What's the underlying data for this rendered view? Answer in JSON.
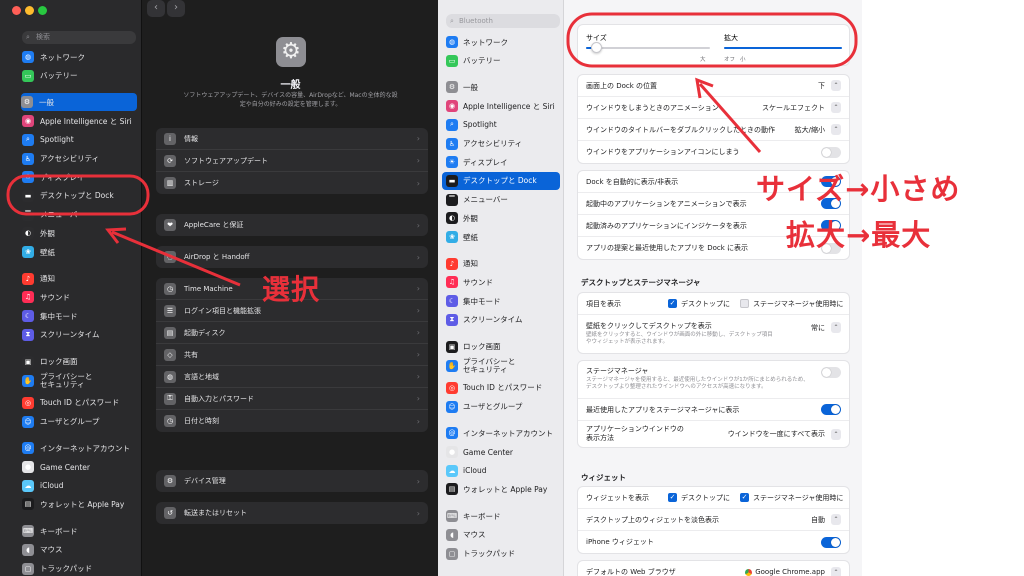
{
  "left": {
    "search_placeholder": "検索",
    "sidebar_items": [
      {
        "label": "ネットワーク",
        "icon": "globe-icon",
        "color": "#1e7cf2"
      },
      {
        "label": "バッテリー",
        "icon": "battery-icon",
        "color": "#34c759"
      },
      {
        "label": "一般",
        "icon": "gear-icon",
        "color": "#8e8e93",
        "selected": true
      },
      {
        "label": "Apple Intelligence と Siri",
        "icon": "siri-icon",
        "color": "#e0457b"
      },
      {
        "label": "Spotlight",
        "icon": "search-icon",
        "color": "#1e7cf2"
      },
      {
        "label": "アクセシビリティ",
        "icon": "accessibility-icon",
        "color": "#1e7cf2"
      },
      {
        "label": "ディスプレイ",
        "icon": "display-icon",
        "color": "#1e7cf2"
      },
      {
        "label": "デスクトップと Dock",
        "icon": "dock-icon",
        "color": "#2c2c2e"
      },
      {
        "label": "メニューバー",
        "icon": "menubar-icon",
        "color": "#2c2c2e"
      },
      {
        "label": "外観",
        "icon": "appearance-icon",
        "color": "#2c2c2e"
      },
      {
        "label": "壁紙",
        "icon": "wallpaper-icon",
        "color": "#32ade6"
      },
      {
        "label": "通知",
        "icon": "bell-icon",
        "color": "#ff3b30"
      },
      {
        "label": "サウンド",
        "icon": "speaker-icon",
        "color": "#ff2d55"
      },
      {
        "label": "集中モード",
        "icon": "moon-icon",
        "color": "#5e5ce6"
      },
      {
        "label": "スクリーンタイム",
        "icon": "hourglass-icon",
        "color": "#5e5ce6"
      },
      {
        "label": "ロック画面",
        "icon": "lock-screen-icon",
        "color": "#2c2c2e"
      },
      {
        "label": "プライバシーと",
        "label2": "セキュリティ",
        "icon": "hand-icon",
        "color": "#1e7cf2"
      },
      {
        "label": "Touch ID とパスワード",
        "icon": "fingerprint-icon",
        "color": "#ff3b30"
      },
      {
        "label": "ユーザとグループ",
        "icon": "users-icon",
        "color": "#1e7cf2"
      },
      {
        "label": "インターネットアカウント",
        "icon": "at-icon",
        "color": "#1e7cf2"
      },
      {
        "label": "Game Center",
        "icon": "game-center-icon",
        "color": "#e5e5e7"
      },
      {
        "label": "iCloud",
        "icon": "cloud-icon",
        "color": "#5ac8fa"
      },
      {
        "label": "ウォレットと Apple Pay",
        "icon": "wallet-icon",
        "color": "#1c1c1e"
      },
      {
        "label": "キーボード",
        "icon": "keyboard-icon",
        "color": "#8e8e93"
      },
      {
        "label": "マウス",
        "icon": "mouse-icon",
        "color": "#8e8e93"
      },
      {
        "label": "トラックパッド",
        "icon": "trackpad-icon",
        "color": "#8e8e93"
      }
    ],
    "main": {
      "title": "一般",
      "description": "ソフトウェアアップデート、デバイスの容量、AirDropなど、Macの全体的な設定や自分の好みの設定を管理します。",
      "groups": [
        [
          {
            "label": "情報",
            "icon": "info-icon"
          },
          {
            "label": "ソフトウェアアップデート",
            "icon": "software-update-icon"
          },
          {
            "label": "ストレージ",
            "icon": "storage-icon"
          }
        ],
        [
          {
            "label": "AppleCare と保証",
            "icon": "applecare-icon"
          }
        ],
        [
          {
            "label": "AirDrop と Handoff",
            "icon": "airdrop-icon"
          }
        ],
        [
          {
            "label": "Time Machine",
            "icon": "time-machine-icon"
          },
          {
            "label": "ログイン項目と機能拡張",
            "icon": "login-items-icon"
          },
          {
            "label": "起動ディスク",
            "icon": "startup-disk-icon"
          },
          {
            "label": "共有",
            "icon": "sharing-icon"
          },
          {
            "label": "言語と地域",
            "icon": "language-icon"
          },
          {
            "label": "自動入力とパスワード",
            "icon": "autofill-icon"
          },
          {
            "label": "日付と時刻",
            "icon": "clock-icon"
          }
        ],
        [
          {
            "label": "デバイス管理",
            "icon": "device-management-icon"
          }
        ],
        [
          {
            "label": "転送またはリセット",
            "icon": "reset-icon"
          }
        ]
      ]
    }
  },
  "right": {
    "search_placeholder": "Bluetooth",
    "sidebar_items": [
      {
        "label": "ネットワーク",
        "icon": "globe-icon",
        "color": "#1e7cf2"
      },
      {
        "label": "バッテリー",
        "icon": "battery-icon",
        "color": "#34c759"
      },
      {
        "label": "一般",
        "icon": "gear-icon",
        "color": "#8e8e93"
      },
      {
        "label": "Apple Intelligence と Siri",
        "icon": "siri-icon",
        "color": "#e0457b"
      },
      {
        "label": "Spotlight",
        "icon": "search-icon",
        "color": "#1e7cf2"
      },
      {
        "label": "アクセシビリティ",
        "icon": "accessibility-icon",
        "color": "#1e7cf2"
      },
      {
        "label": "ディスプレイ",
        "icon": "display-icon",
        "color": "#1e7cf2"
      },
      {
        "label": "デスクトップと Dock",
        "icon": "dock-icon",
        "color": "#1c1c1e",
        "selected": true
      },
      {
        "label": "メニューバー",
        "icon": "menubar-icon",
        "color": "#1c1c1e"
      },
      {
        "label": "外観",
        "icon": "appearance-icon",
        "color": "#1c1c1e"
      },
      {
        "label": "壁紙",
        "icon": "wallpaper-icon",
        "color": "#32ade6"
      },
      {
        "label": "通知",
        "icon": "bell-icon",
        "color": "#ff3b30"
      },
      {
        "label": "サウンド",
        "icon": "speaker-icon",
        "color": "#ff2d55"
      },
      {
        "label": "集中モード",
        "icon": "moon-icon",
        "color": "#5e5ce6"
      },
      {
        "label": "スクリーンタイム",
        "icon": "hourglass-icon",
        "color": "#5e5ce6"
      },
      {
        "label": "ロック画面",
        "icon": "lock-screen-icon",
        "color": "#1c1c1e"
      },
      {
        "label": "プライバシーと",
        "label2": "セキュリティ",
        "icon": "hand-icon",
        "color": "#1e7cf2"
      },
      {
        "label": "Touch ID とパスワード",
        "icon": "fingerprint-icon",
        "color": "#ff3b30"
      },
      {
        "label": "ユーザとグループ",
        "icon": "users-icon",
        "color": "#1e7cf2"
      },
      {
        "label": "インターネットアカウント",
        "icon": "at-icon",
        "color": "#1e7cf2"
      },
      {
        "label": "Game Center",
        "icon": "game-center-icon",
        "color": "#e5e5e7"
      },
      {
        "label": "iCloud",
        "icon": "cloud-icon",
        "color": "#5ac8fa"
      },
      {
        "label": "ウォレットと Apple Pay",
        "icon": "wallet-icon",
        "color": "#1c1c1e"
      },
      {
        "label": "キーボード",
        "icon": "keyboard-icon",
        "color": "#8e8e93"
      },
      {
        "label": "マウス",
        "icon": "mouse-icon",
        "color": "#8e8e93"
      },
      {
        "label": "トラックパッド",
        "icon": "trackpad-icon",
        "color": "#8e8e93"
      }
    ],
    "dock": {
      "size_label": "サイズ",
      "size_value": 0.08,
      "size_max_label": "大",
      "magnification_label": "拡大",
      "magnification_value": 1.0,
      "mag_off_label": "オフ",
      "mag_small_label": "小",
      "mag_large_label": "大",
      "rows_a": [
        {
          "label": "画面上の Dock の位置",
          "value": "下",
          "control": "stepper"
        },
        {
          "label": "ウインドウをしまうときのアニメーション",
          "value": "スケールエフェクト",
          "control": "stepper"
        },
        {
          "label": "ウインドウのタイトルバーをダブルクリックしたときの動作",
          "value": "拡大/縮小",
          "control": "stepper"
        },
        {
          "label": "ウインドウをアプリケーションアイコンにしまう",
          "control": "toggle",
          "on": false
        }
      ],
      "rows_b": [
        {
          "label": "Dock を自動的に表示/非表示",
          "control": "toggle",
          "on": true
        },
        {
          "label": "起動中のアプリケーションをアニメーションで表示",
          "control": "toggle",
          "on": true
        },
        {
          "label": "起動済みのアプリケーションにインジケータを表示",
          "control": "toggle",
          "on": true
        },
        {
          "label": "アプリの提案と最近使用したアプリを Dock に表示",
          "control": "toggle",
          "on": false
        }
      ]
    },
    "stage": {
      "section_title": "デスクトップとステージマネージャ",
      "show_items_label": "項目を表示",
      "desktop_check_label": "デスクトップに",
      "desktop_checked": true,
      "stage_check_label": "ステージマネージャ使用時に",
      "stage_checked": false,
      "wallpaper_label": "壁紙をクリックしてデスクトップを表示",
      "wallpaper_sub": "壁紙をクリックすると、ウインドウが画面の外に移動し、デスクトップ項目やウィジェットが表示されます。",
      "wallpaper_value": "常に",
      "stage_label": "ステージマネージャ",
      "stage_sub": "ステージマネージャを使用すると、最近使用したウインドウが1か所にまとめられるため、デスクトップより整理されたウインドウへのアクセスが高速になります。",
      "recent_apps_label": "最近使用したアプリをステージマネージャに表示",
      "app_windows_label": "アプリケーションウインドウの",
      "app_windows_label2": "表示方法",
      "app_windows_value": "ウインドウを一度にすべて表示"
    },
    "widgets": {
      "section_title": "ウィジェット",
      "show_label": "ウィジェットを表示",
      "desktop_check_label": "デスクトップに",
      "stage_check_label": "ステージマネージャ使用時に",
      "mono_label": "デスクトップ上のウィジェットを淡色表示",
      "mono_value": "自動",
      "iphone_label": "iPhone ウィジェット"
    },
    "browser": {
      "label": "デフォルトの Web ブラウザ",
      "value": "Google Chrome.app"
    }
  },
  "annotations": {
    "select": "選択",
    "size_note": "サイズ→小さめ",
    "mag_note": "拡大→最大",
    "color": "#e8303a"
  }
}
